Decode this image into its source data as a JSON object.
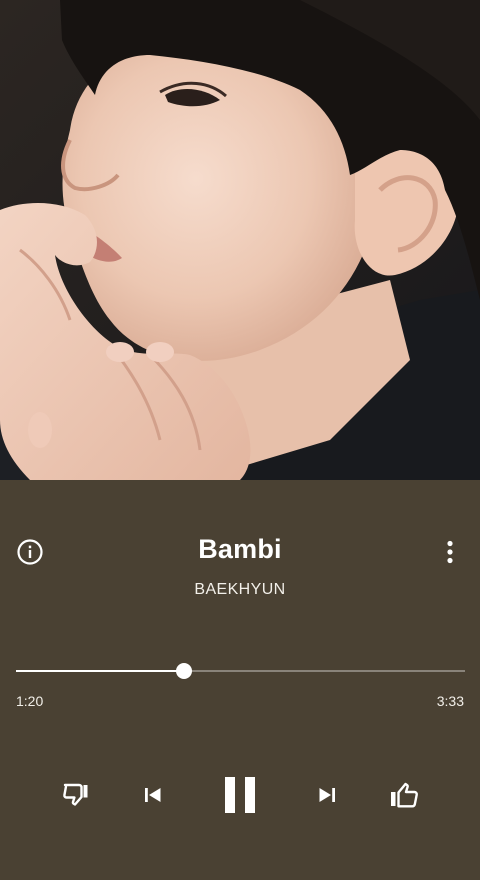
{
  "track": {
    "title": "Bambi",
    "artist": "BAEKHYUN"
  },
  "playback": {
    "current_time": "1:20",
    "total_time": "3:33",
    "progress_fraction": 0.375,
    "state": "playing"
  },
  "icons": {
    "info": "info-icon",
    "more": "more-vertical-icon",
    "dislike": "thumb-down-icon",
    "previous": "skip-previous-icon",
    "pause": "pause-icon",
    "next": "skip-next-icon",
    "like": "thumb-up-icon"
  },
  "colors": {
    "background": "#4a4133",
    "text": "#ffffff",
    "track_inactive": "rgba(255,255,255,0.35)"
  }
}
